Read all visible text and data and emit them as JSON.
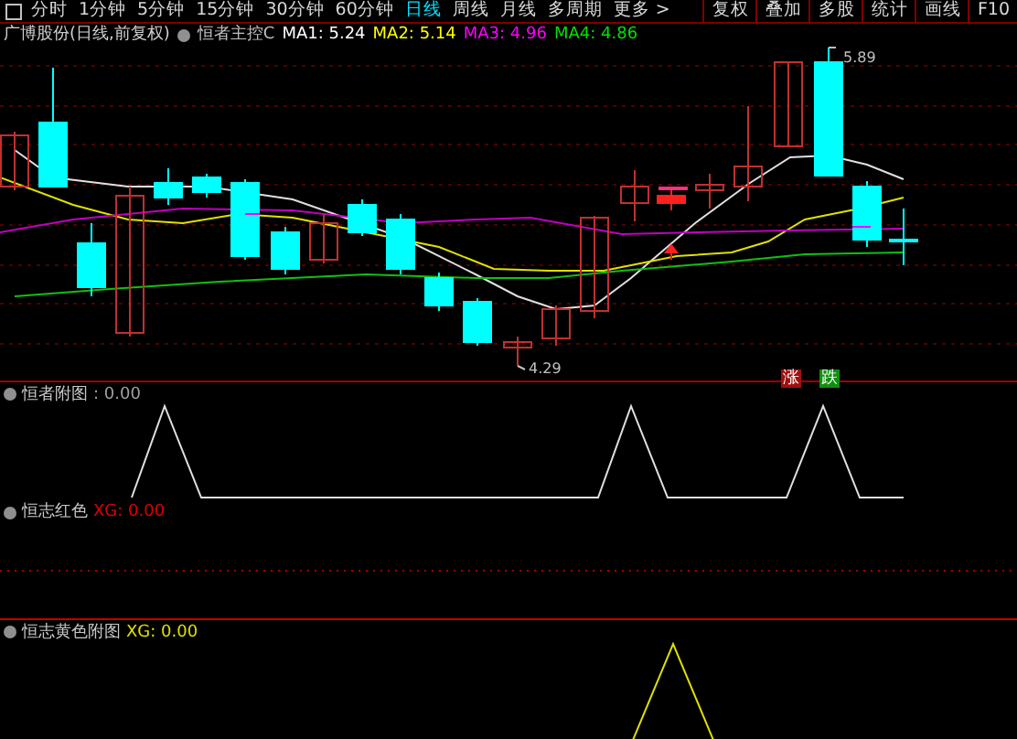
{
  "toolbar": {
    "tabs": [
      {
        "label": "分时",
        "selected": false
      },
      {
        "label": "1分钟",
        "selected": false
      },
      {
        "label": "5分钟",
        "selected": false
      },
      {
        "label": "15分钟",
        "selected": false
      },
      {
        "label": "30分钟",
        "selected": false
      },
      {
        "label": "60分钟",
        "selected": false
      },
      {
        "label": "日线",
        "selected": true
      },
      {
        "label": "周线",
        "selected": false
      },
      {
        "label": "月线",
        "selected": false
      },
      {
        "label": "多周期",
        "selected": false
      },
      {
        "label": "更多 >",
        "selected": false
      }
    ],
    "actions": [
      "复权",
      "叠加",
      "多股",
      "统计",
      "画线",
      "F10"
    ]
  },
  "main_chart": {
    "title": "广博股份(日线,前复权)",
    "indicator": "恒者主控C",
    "moving_averages": [
      {
        "label": "MA1: 5.24",
        "color": "#ffffff"
      },
      {
        "label": "MA2: 5.14",
        "color": "#ffff00"
      },
      {
        "label": "MA3: 4.96",
        "color": "#ff00ff"
      },
      {
        "label": "MA4: 4.86",
        "color": "#00e000"
      }
    ],
    "high_label": "5.89",
    "low_label": "4.29",
    "signals": [
      {
        "label": "涨",
        "color": "#a01010"
      },
      {
        "label": "跌",
        "color": "#109010"
      }
    ]
  },
  "panels": [
    {
      "name": "恒者附图",
      "value": ": 0.00",
      "color": "#a0a0a0"
    },
    {
      "name": "恒志红色",
      "value": "XG: 0.00",
      "color": "#e00000"
    },
    {
      "name": "恒志黄色附图",
      "value": "XG: 0.00",
      "color": "#e0e000"
    }
  ]
}
